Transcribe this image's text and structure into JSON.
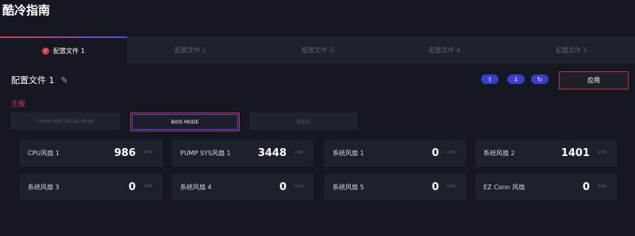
{
  "app": {
    "title": "酷冷指南"
  },
  "tabs": [
    {
      "label": "配置文件 1"
    },
    {
      "label": "配置文件 2"
    },
    {
      "label": "配置文件 3"
    },
    {
      "label": "配置文件 4"
    },
    {
      "label": "配置文件 5"
    }
  ],
  "profile": {
    "name": "配置文件 1",
    "apply_label": "应用"
  },
  "toolbar": {
    "icons": [
      "upload-icon",
      "download-icon",
      "refresh-icon"
    ]
  },
  "section": {
    "label": "主板"
  },
  "modes": [
    {
      "label": "Follow MSI Center Mode"
    },
    {
      "label": "BIOS MODE"
    },
    {
      "label": "自定义"
    }
  ],
  "fans": [
    {
      "name": "CPU风扇 1",
      "value": "986",
      "unit": "RPM"
    },
    {
      "name": "PUMP SYS风扇 1",
      "value": "3448",
      "unit": "RPM"
    },
    {
      "name": "系统风扇 1",
      "value": "0",
      "unit": "RPM"
    },
    {
      "name": "系统风扇 2",
      "value": "1401",
      "unit": "RPM"
    },
    {
      "name": "系统风扇 3",
      "value": "0",
      "unit": "RPM"
    },
    {
      "name": "系统风扇 4",
      "value": "0",
      "unit": "RPM"
    },
    {
      "name": "系统风扇 5",
      "value": "0",
      "unit": "RPM"
    },
    {
      "name": "EZ Conn 风扇",
      "value": "0",
      "unit": "RPM"
    }
  ],
  "colors": {
    "accent_red": "#e0344a",
    "accent_blue": "#3a3fd0",
    "background": "#151821"
  }
}
